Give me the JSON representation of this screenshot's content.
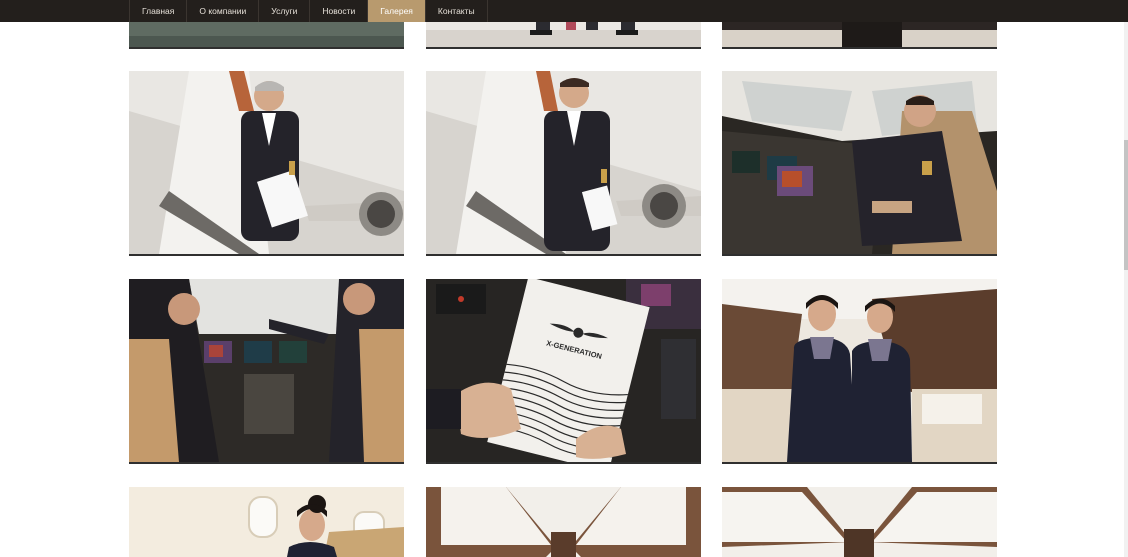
{
  "nav": {
    "items": [
      {
        "label": "Главная"
      },
      {
        "label": "О компании"
      },
      {
        "label": "Услуги"
      },
      {
        "label": "Новости"
      },
      {
        "label": "Галерея",
        "active": true
      },
      {
        "label": "Контакты"
      }
    ],
    "active_color": "#b89a6e",
    "bar_color": "#231f1c"
  },
  "gallery": {
    "brochure_title": "X-GENERATION"
  }
}
